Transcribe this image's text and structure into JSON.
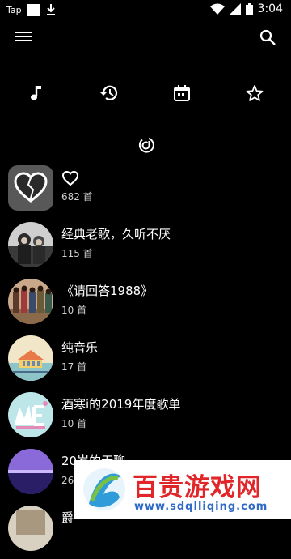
{
  "status_bar": {
    "left_label": "Tap",
    "time": "3:04"
  },
  "appbar": {
    "menu_icon": "menu-icon",
    "search_icon": "search-icon"
  },
  "tabs": [
    {
      "name": "music-note-icon"
    },
    {
      "name": "history-icon"
    },
    {
      "name": "calendar-icon"
    },
    {
      "name": "star-icon"
    }
  ],
  "center_icon": "netease-icon",
  "playlists": [
    {
      "title": "",
      "count": "682 首",
      "kind": "favorite"
    },
    {
      "title": "经典老歌，久听不厌",
      "count": "115 首"
    },
    {
      "title": "《请回答1988》",
      "count": "10 首"
    },
    {
      "title": "纯音乐",
      "count": "17 首"
    },
    {
      "title": "酒寒i的2019年度歌单",
      "count": "10 首"
    },
    {
      "title": "20岁的无聊",
      "count": "26 首"
    },
    {
      "title": "爵",
      "count": ""
    }
  ],
  "watermark": {
    "text": "百贵游戏网",
    "url": "www.sdqlliqing.com"
  },
  "colors": {
    "background": "#000000",
    "text_primary": "#ffffff",
    "text_secondary": "#cfcfcf",
    "watermark_red": "#e1262a",
    "watermark_blue": "#2f6bc6"
  }
}
